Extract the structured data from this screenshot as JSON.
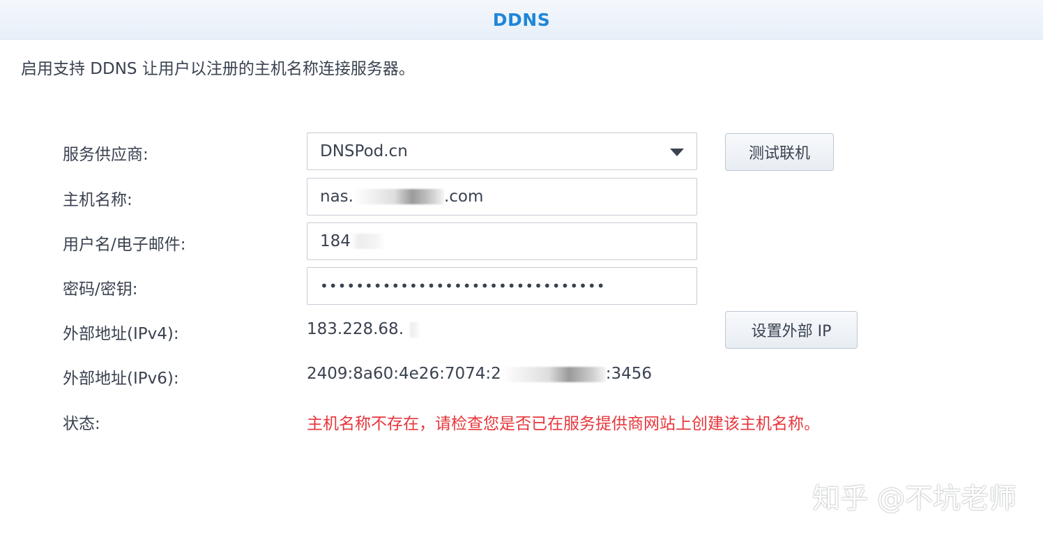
{
  "header": {
    "title": "DDNS"
  },
  "description": "启用支持 DDNS 让用户以注册的主机名称连接服务器。",
  "form": {
    "provider": {
      "label": "服务供应商:",
      "value": "DNSPod.cn"
    },
    "hostname": {
      "label": "主机名称:",
      "value_prefix": "nas.",
      "value_suffix": ".com"
    },
    "username": {
      "label": "用户名/电子邮件:",
      "value_prefix": "184"
    },
    "password": {
      "label": "密码/密钥:",
      "value": "••••••••••••••••••••••••••••••••"
    },
    "ipv4": {
      "label": "外部地址(IPv4):",
      "value_prefix": "183.228.68."
    },
    "ipv6": {
      "label": "外部地址(IPv6):",
      "value_prefix": "2409:8a60:4e26:7074:2",
      "value_suffix": ":3456"
    },
    "status": {
      "label": "状态:",
      "value": "主机名称不存在，请检查您是否已在服务提供商网站上创建该主机名称。",
      "color": "#e6363b"
    }
  },
  "buttons": {
    "test_connection": "测试联机",
    "set_external_ip": "设置外部 IP"
  },
  "watermark": "知乎 @不坑老师",
  "colors": {
    "accent": "#1f86d9",
    "error": "#e6363b"
  }
}
